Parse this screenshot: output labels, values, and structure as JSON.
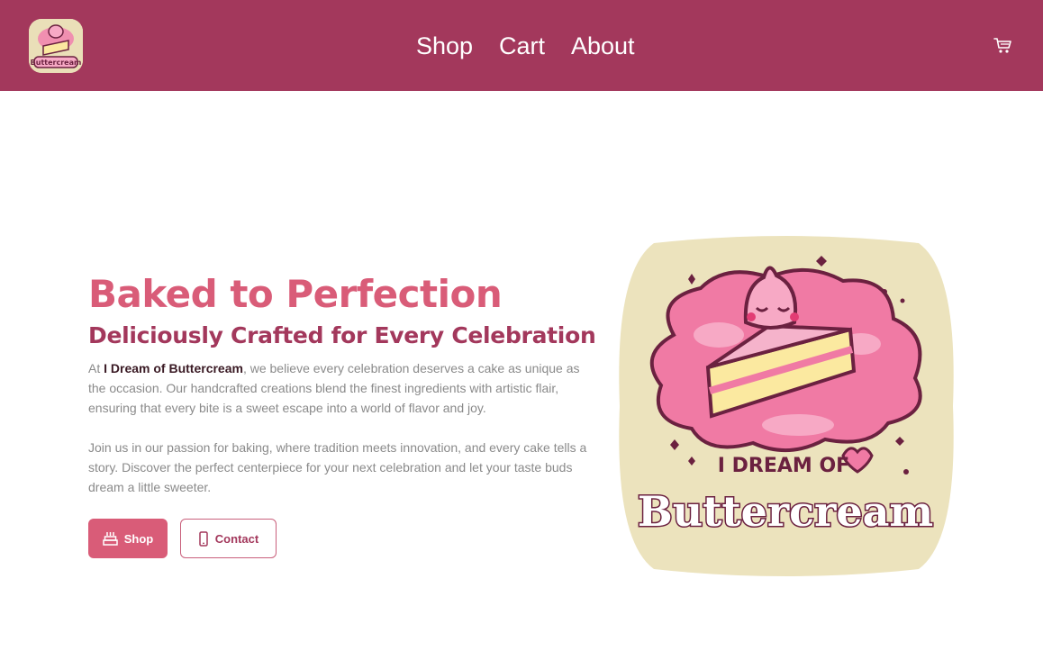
{
  "navbar": {
    "links": [
      {
        "label": "Shop"
      },
      {
        "label": "Cart"
      },
      {
        "label": "About"
      }
    ],
    "logo_icon": "cake-logo-icon",
    "cart_icon": "shopping-cart-icon"
  },
  "hero": {
    "title": "Baked to Perfection",
    "subtitle": "Deliciously Crafted for Every Celebration",
    "paragraph1": {
      "prefix": "At ",
      "brand": "I Dream of Buttercream",
      "suffix": ", we believe every celebration deserves a cake as unique as the occasion. Our handcrafted creations blend the finest ingredients with artistic flair, ensuring that every bite is a sweet escape into a world of flavor and joy."
    },
    "paragraph2": "Join us in our passion for baking, where tradition meets innovation, and every cake tells a story. Discover the perfect centerpiece for your next celebration and let your taste buds dream a little sweeter.",
    "buttons": {
      "shop_label": "Shop",
      "shop_icon": "cake-icon",
      "contact_label": "Contact",
      "contact_icon": "phone-icon"
    },
    "image_text": {
      "line1": "I DREAM OF",
      "line2": "Buttercream"
    }
  },
  "colors": {
    "nav_background": "#a3385c",
    "title": "#d95c78",
    "subtitle": "#a3385c",
    "button_primary": "#d95c78",
    "body_text": "#8a8a8a"
  }
}
